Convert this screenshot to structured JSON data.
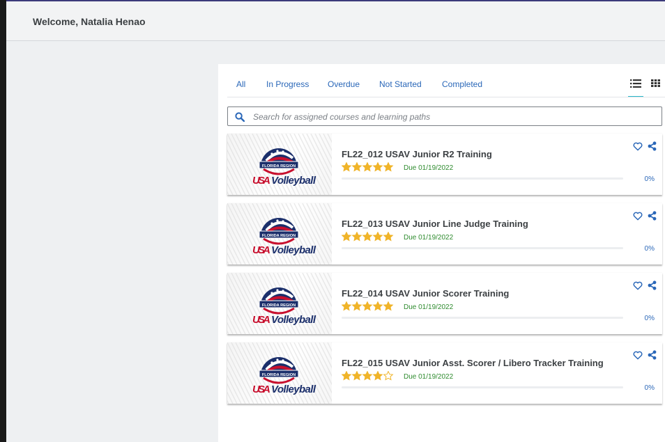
{
  "header": {
    "welcome": "Welcome, Natalia Henao"
  },
  "tabs": [
    {
      "label": "All"
    },
    {
      "label": "In Progress"
    },
    {
      "label": "Overdue"
    },
    {
      "label": "Not Started"
    },
    {
      "label": "Completed"
    }
  ],
  "view_toggle": {
    "active": "list",
    "icons": [
      "list-view-icon",
      "grid-view-icon"
    ]
  },
  "search": {
    "placeholder": "Search for assigned courses and learning paths",
    "value": ""
  },
  "courses": [
    {
      "title": "FL22_012 USAV Junior R2 Training",
      "rating": 5,
      "due": "Due 01/19/2022",
      "progress": 0,
      "progress_label": "0%",
      "thumbnail_text": [
        "FLORIDA REGION",
        "USA",
        "Volleyball"
      ]
    },
    {
      "title": "FL22_013 USAV Junior Line Judge Training",
      "rating": 5,
      "due": "Due 01/19/2022",
      "progress": 0,
      "progress_label": "0%",
      "thumbnail_text": [
        "FLORIDA REGION",
        "USA",
        "Volleyball"
      ]
    },
    {
      "title": "FL22_014 USAV Junior Scorer Training",
      "rating": 5,
      "due": "Due 01/19/2022",
      "progress": 0,
      "progress_label": "0%",
      "thumbnail_text": [
        "FLORIDA REGION",
        "USA",
        "Volleyball"
      ]
    },
    {
      "title": "FL22_015 USAV Junior Asst. Scorer / Libero Tracker Training",
      "rating": 4,
      "due": "Due 01/19/2022",
      "progress": 0,
      "progress_label": "0%",
      "thumbnail_text": [
        "FLORIDA REGION",
        "USA",
        "Volleyball"
      ]
    }
  ],
  "colors": {
    "link": "#2a67b8",
    "active_tab_indicator": "#2ab7c9",
    "star": "#f0b429",
    "due": "#2e8b2e",
    "logo_navy": "#1b2f6b",
    "logo_red": "#c8102e"
  }
}
